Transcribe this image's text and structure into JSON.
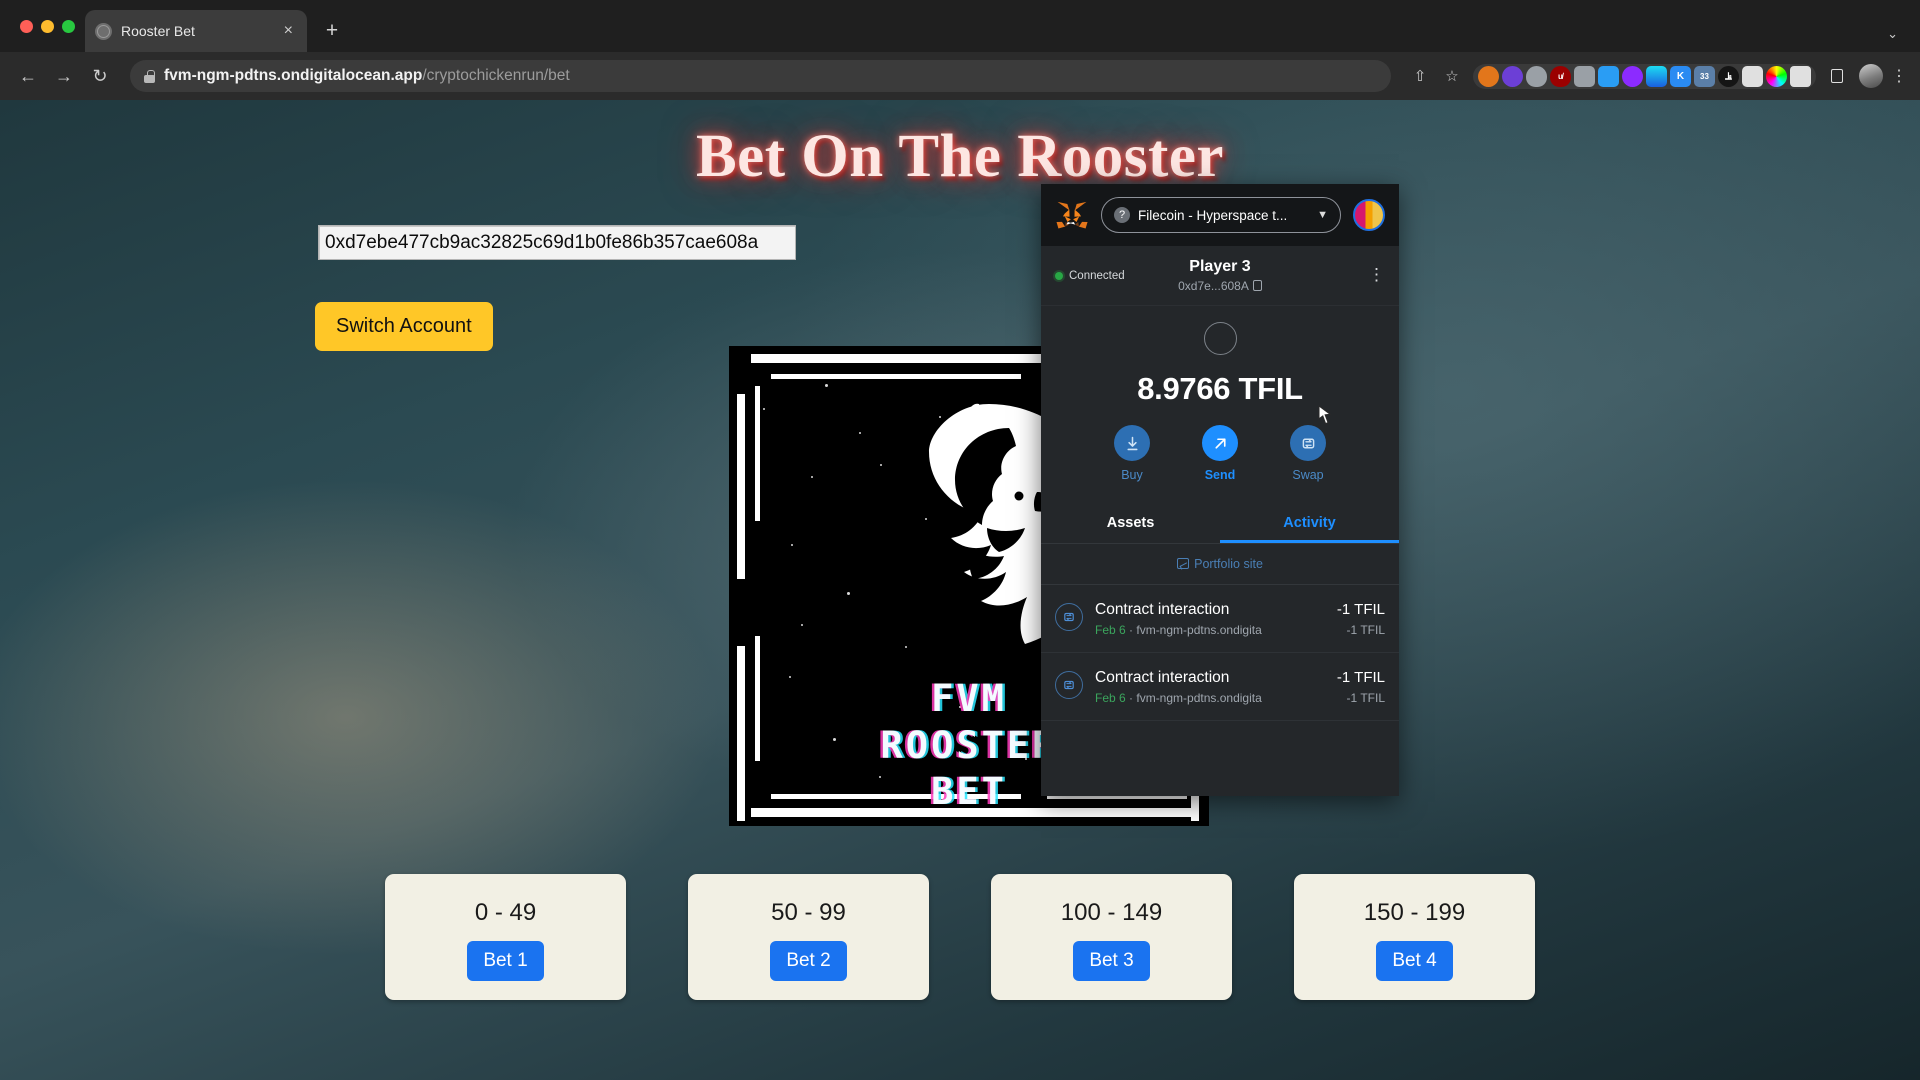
{
  "browser": {
    "tab": {
      "title": "Rooster Bet",
      "favicon": "globe-icon",
      "close": "×"
    },
    "new_tab": "+",
    "collapse": "⌄",
    "nav": {
      "back": "←",
      "forward": "→",
      "reload": "↻"
    },
    "url": {
      "host": "fvm-ngm-pdtns.ondigitalocean.app",
      "path": "/cryptochickenrun/bet"
    },
    "right_icons": [
      {
        "name": "share-icon",
        "glyph": "⇧"
      },
      {
        "name": "bookmark-star-icon",
        "glyph": "☆"
      }
    ],
    "extensions": [
      {
        "name": "metamask-extension-icon",
        "label": "",
        "color": "#e2761b"
      },
      {
        "name": "ghost-extension-icon",
        "label": "",
        "color": "#6c3fd6"
      },
      {
        "name": "shield-extension-icon",
        "label": "",
        "color": "#9aa0a6"
      },
      {
        "name": "ublock-extension-icon",
        "label": "u̸",
        "color": "#9b0000"
      },
      {
        "name": "camera-extension-icon",
        "label": "",
        "color": "#9aa0a6"
      },
      {
        "name": "image-extension-icon",
        "label": "",
        "color": "#2a9df4"
      },
      {
        "name": "moon-extension-icon",
        "label": "",
        "color": "#8c2bff"
      },
      {
        "name": "funnel-extension-icon",
        "label": "",
        "color": "#14c8c8"
      },
      {
        "name": "keeper-extension-icon",
        "label": "K",
        "color": "#2a8bf2"
      },
      {
        "name": "badge-extension-icon",
        "label": "33",
        "color": "#5b7fa8"
      },
      {
        "name": "monkey-extension-icon",
        "label": "⫡",
        "color": "#1a1a1a"
      },
      {
        "name": "book-extension-icon",
        "label": "",
        "color": "#d8d8d8"
      },
      {
        "name": "color-wheel-extension-icon",
        "label": "",
        "color": "#34c759"
      },
      {
        "name": "puzzle-extensions-icon",
        "label": "",
        "color": "#d8d8d8"
      },
      {
        "name": "sidepanel-icon",
        "label": "",
        "color": "#e8e8e8"
      }
    ],
    "profile_avatar": "profile-avatar",
    "menu": "⋮"
  },
  "page": {
    "title": "Bet On The Rooster",
    "address_value": "0xd7ebe477cb9ac32825c69d1b0fe86b357cae608a",
    "switch_account_label": "Switch Account",
    "poster": {
      "alt": "FVM Rooster Bet poster",
      "line1": "FVM",
      "line2": "ROOSTER",
      "line3": "BET"
    },
    "bets": [
      {
        "range": "0 - 49",
        "button": "Bet 1"
      },
      {
        "range": "50 - 99",
        "button": "Bet 2"
      },
      {
        "range": "100 - 149",
        "button": "Bet 3"
      },
      {
        "range": "150 - 199",
        "button": "Bet 4"
      }
    ]
  },
  "metamask": {
    "network": "Filecoin - Hyperspace t...",
    "connection_status": "Connected",
    "account_name": "Player 3",
    "account_address": "0xd7e...608A",
    "balance": "8.9766 TFIL",
    "actions": [
      {
        "label": "Buy",
        "icon": "download-icon"
      },
      {
        "label": "Send",
        "icon": "arrow-up-right-icon"
      },
      {
        "label": "Swap",
        "icon": "swap-icon"
      }
    ],
    "tabs": [
      {
        "label": "Assets",
        "active": false
      },
      {
        "label": "Activity",
        "active": true
      }
    ],
    "portfolio_link": "Portfolio site",
    "transactions": [
      {
        "title": "Contract interaction",
        "date": "Feb 6",
        "site": "fvm-ngm-pdtns.ondigita",
        "amount": "-1 TFIL",
        "amount_fiat": "-1 TFIL"
      },
      {
        "title": "Contract interaction",
        "date": "Feb 6",
        "site": "fvm-ngm-pdtns.ondigita",
        "amount": "-1 TFIL",
        "amount_fiat": "-1 TFIL"
      }
    ],
    "accent_color": "#1e8fff",
    "connected_color": "#28a745"
  }
}
